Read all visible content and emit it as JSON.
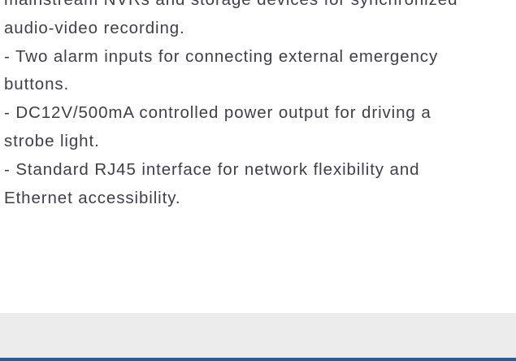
{
  "description": {
    "lines": [
      "mainstream NVRs and storage devices for synchronized",
      "audio-video recording.",
      "- Two alarm inputs for connecting external emergency",
      "buttons.",
      "- DC12V/500mA controlled power output for driving a",
      "strobe light.",
      "- Standard RJ45 interface for network flexibility and",
      "Ethernet accessibility."
    ]
  },
  "colors": {
    "text": "#3f3f46",
    "footer_band": "#ececec",
    "footer_accent": "#1d5fa0"
  }
}
